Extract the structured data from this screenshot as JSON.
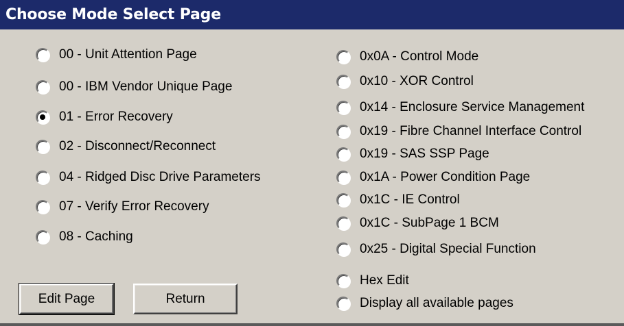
{
  "title": "Choose Mode Select Page",
  "left_options": [
    {
      "label": "00 - Unit Attention Page",
      "checked": false
    },
    {
      "label": "00 - IBM Vendor Unique Page",
      "checked": false
    },
    {
      "label": "01 - Error Recovery",
      "checked": true
    },
    {
      "label": "02 - Disconnect/Reconnect",
      "checked": false
    },
    {
      "label": "04 - Ridged Disc Drive Parameters",
      "checked": false
    },
    {
      "label": "07 - Verify Error Recovery",
      "checked": false
    },
    {
      "label": "08 - Caching",
      "checked": false
    }
  ],
  "right_options": [
    {
      "label": "0x0A - Control Mode",
      "checked": false
    },
    {
      "label": "0x10 - XOR Control",
      "checked": false
    },
    {
      "label": "0x14 - Enclosure Service Management",
      "checked": false
    },
    {
      "label": "0x19 - Fibre Channel Interface Control",
      "checked": false
    },
    {
      "label": "0x19 - SAS SSP Page",
      "checked": false
    },
    {
      "label": "0x1A - Power Condition Page",
      "checked": false
    },
    {
      "label": "0x1C - IE Control",
      "checked": false
    },
    {
      "label": "0x1C - SubPage 1 BCM",
      "checked": false
    },
    {
      "label": "0x25 - Digital Special Function",
      "checked": false
    },
    {
      "label": "Hex Edit",
      "checked": false
    },
    {
      "label": "Display all available pages",
      "checked": false
    }
  ],
  "buttons": {
    "edit_page": "Edit Page",
    "return": "Return"
  },
  "colors": {
    "titlebar_bg": "#1c2a6a",
    "window_bg": "#d4d0c8"
  }
}
